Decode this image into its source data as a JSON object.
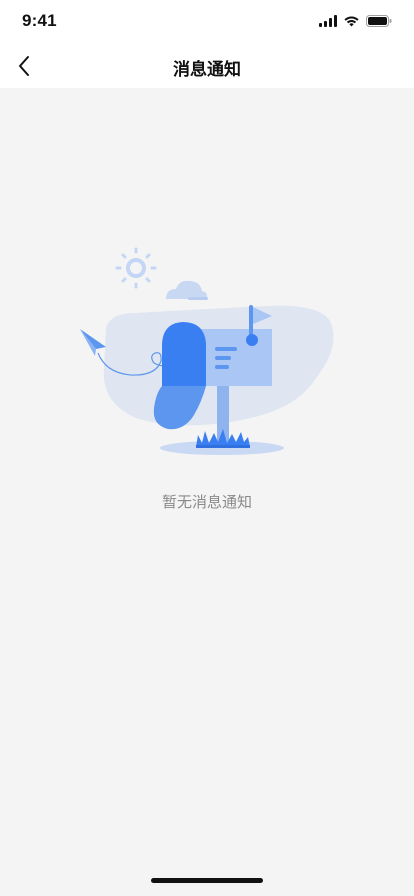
{
  "status_bar": {
    "time": "9:41",
    "icons": [
      "cellular-signal-icon",
      "wifi-icon",
      "battery-icon"
    ]
  },
  "nav": {
    "title": "消息通知",
    "back_icon": "chevron-left-icon"
  },
  "empty_state": {
    "message": "暂无消息通知",
    "illustration": "mailbox-illustration"
  },
  "colors": {
    "accent": "#2f7df6",
    "accent_light": "#a9c6f5",
    "blob": "#dfe6f2",
    "background": "#f4f4f4"
  }
}
